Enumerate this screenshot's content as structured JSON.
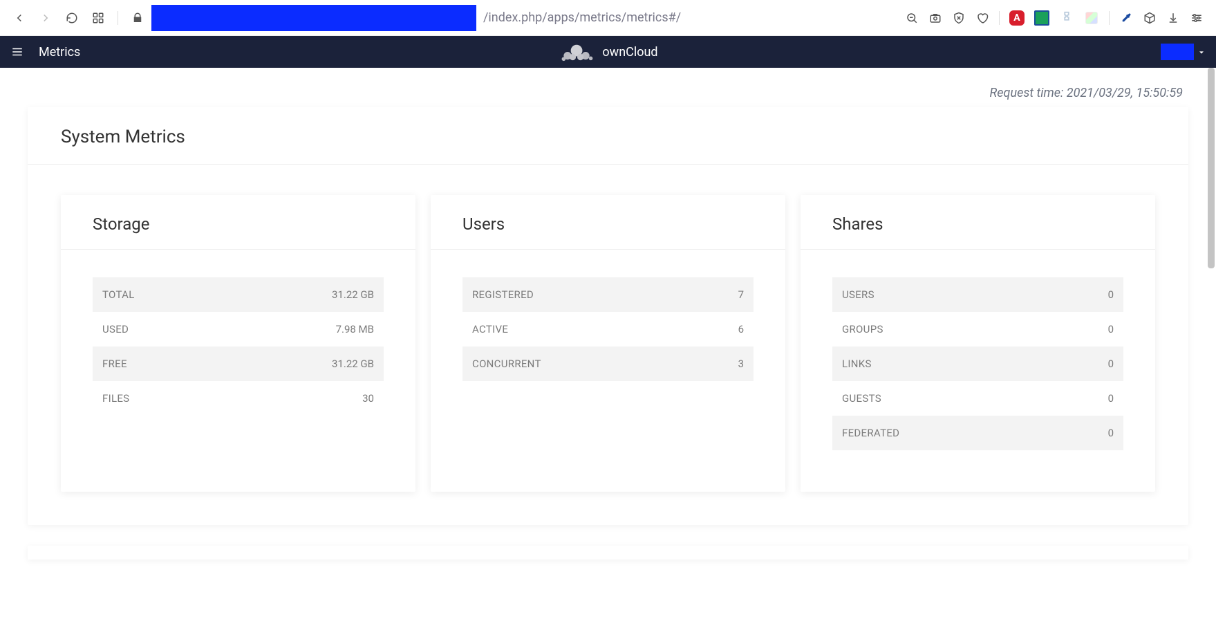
{
  "browser": {
    "url_suffix": "/index.php/apps/metrics/metrics#/"
  },
  "header": {
    "app_name": "Metrics",
    "brand": "ownCloud"
  },
  "request_time": "Request time: 2021/03/29, 15:50:59",
  "panel_title": "System Metrics",
  "cards": {
    "storage": {
      "title": "Storage",
      "rows": {
        "total": {
          "label": "TOTAL",
          "value": "31.22 GB"
        },
        "used": {
          "label": "USED",
          "value": "7.98 MB"
        },
        "free": {
          "label": "FREE",
          "value": "31.22 GB"
        },
        "files": {
          "label": "FILES",
          "value": "30"
        }
      }
    },
    "users": {
      "title": "Users",
      "rows": {
        "registered": {
          "label": "REGISTERED",
          "value": "7"
        },
        "active": {
          "label": "ACTIVE",
          "value": "6"
        },
        "concurrent": {
          "label": "CONCURRENT",
          "value": "3"
        }
      }
    },
    "shares": {
      "title": "Shares",
      "rows": {
        "users": {
          "label": "USERS",
          "value": "0"
        },
        "groups": {
          "label": "GROUPS",
          "value": "0"
        },
        "links": {
          "label": "LINKS",
          "value": "0"
        },
        "guests": {
          "label": "GUESTS",
          "value": "0"
        },
        "federated": {
          "label": "FEDERATED",
          "value": "0"
        }
      }
    }
  }
}
